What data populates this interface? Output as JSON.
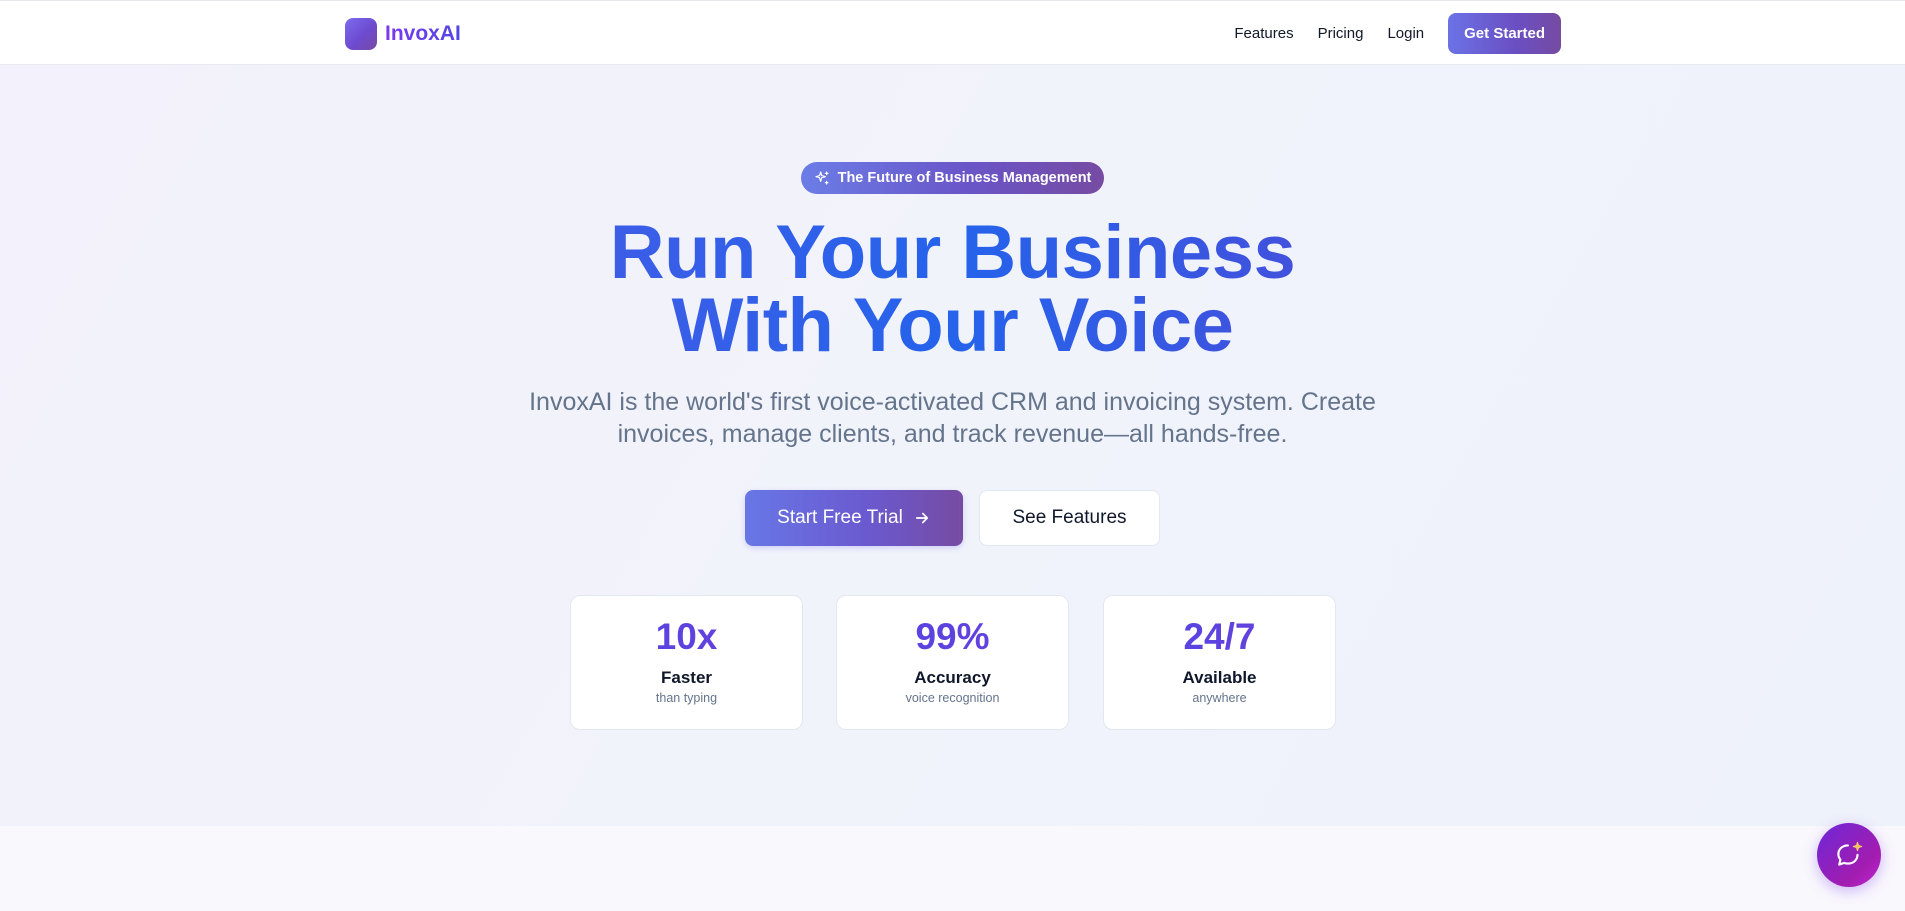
{
  "nav": {
    "brand": "InvoxAI",
    "links": [
      "Features",
      "Pricing",
      "Login"
    ],
    "cta": "Get Started"
  },
  "hero": {
    "badge": "The Future of Business Management",
    "headline_line1": "Run Your Business",
    "headline_line2": "With Your Voice",
    "subtext": "InvoxAI is the world's first voice-activated CRM and invoicing system. Create invoices, manage clients, and track revenue—all hands-free.",
    "primary_button": "Start Free Trial",
    "secondary_button": "See Features"
  },
  "stats": [
    {
      "value": "10x",
      "label": "Faster",
      "sub": "than typing"
    },
    {
      "value": "99%",
      "label": "Accuracy",
      "sub": "voice recognition"
    },
    {
      "value": "24/7",
      "label": "Available",
      "sub": "anywhere"
    }
  ],
  "icons": {
    "badge": "sparkles-icon",
    "primary_button": "arrow-right-icon",
    "chat": "chat-bubble-icon"
  },
  "colors": {
    "accent_start": "#667eea",
    "accent_end": "#764ba2",
    "headline_blue": "#2563eb",
    "stat_value": "#5b3fe0"
  }
}
